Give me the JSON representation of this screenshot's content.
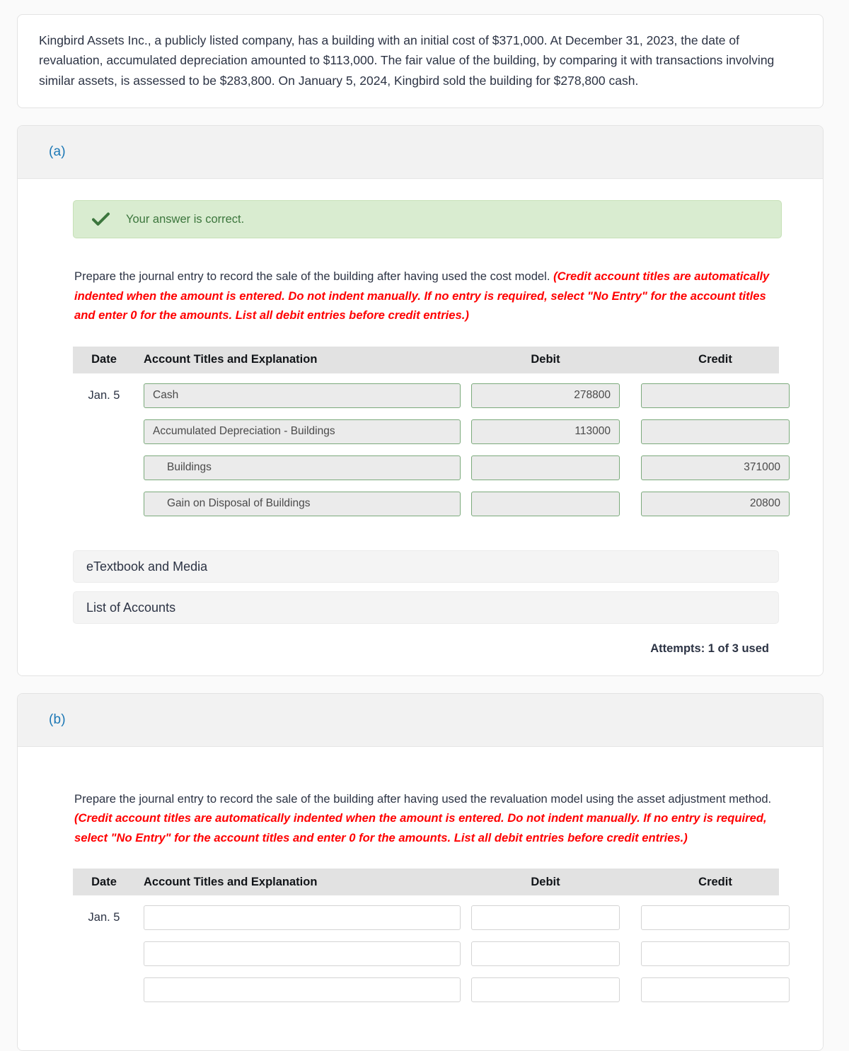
{
  "problem": {
    "text": "Kingbird Assets Inc., a publicly listed company, has a building with an initial cost of $371,000. At December 31, 2023, the date of revaluation, accumulated depreciation amounted to $113,000. The fair value of the building, by comparing it with transactions involving similar assets, is assessed to be $283,800. On January 5, 2024, Kingbird sold the building for $278,800 cash."
  },
  "colors": {
    "part_label": "#1b77b5",
    "note_red": "#ff0000",
    "success_text": "#3c763d",
    "success_bg": "#d9ecd0",
    "locked_border": "#7ba97b",
    "locked_fill": "#ebebeb"
  },
  "table_headers": {
    "date": "Date",
    "account": "Account Titles and Explanation",
    "debit": "Debit",
    "credit": "Credit"
  },
  "part_a": {
    "label": "(a)",
    "feedback": {
      "icon": "check-icon",
      "text": "Your answer is correct."
    },
    "instruction_main": "Prepare the journal entry to record the sale of the building after having used the cost model. ",
    "instruction_note": "(Credit account titles are automatically indented when the amount is entered. Do not indent manually. If no entry is required, select \"No Entry\" for the account titles and enter 0 for the amounts. List all debit entries before credit entries.)",
    "rows": [
      {
        "date": "Jan. 5",
        "account": "Cash",
        "indented": false,
        "debit": "278800",
        "credit": ""
      },
      {
        "date": "",
        "account": "Accumulated Depreciation - Buildings",
        "indented": false,
        "debit": "113000",
        "credit": ""
      },
      {
        "date": "",
        "account": "Buildings",
        "indented": true,
        "debit": "",
        "credit": "371000"
      },
      {
        "date": "",
        "account": "Gain on Disposal of Buildings",
        "indented": true,
        "debit": "",
        "credit": "20800"
      }
    ],
    "etextbook_label": "eTextbook and Media",
    "list_of_accounts_label": "List of Accounts",
    "attempts": "Attempts: 1 of 3 used"
  },
  "part_b": {
    "label": "(b)",
    "instruction_main": "Prepare the journal entry to record the sale of the building after having used the revaluation model using the asset adjustment method. ",
    "instruction_note": "(Credit account titles are automatically indented when the amount is entered. Do not indent manually. If no entry is required, select \"No Entry\" for the account titles and enter 0 for the amounts. List all debit entries before credit entries.)",
    "rows": [
      {
        "date": "Jan. 5",
        "account": "",
        "indented": false,
        "debit": "",
        "credit": ""
      },
      {
        "date": "",
        "account": "",
        "indented": false,
        "debit": "",
        "credit": ""
      },
      {
        "date": "",
        "account": "",
        "indented": false,
        "debit": "",
        "credit": ""
      }
    ]
  }
}
